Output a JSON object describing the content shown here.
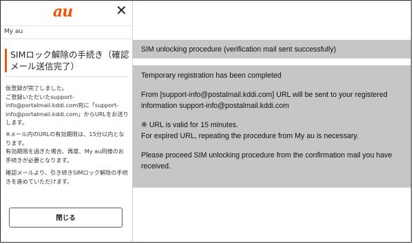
{
  "phone": {
    "logo": "au",
    "close_glyph": "✕",
    "breadcrumb": "My au",
    "title": "SIMロック解除の手続き（確認メール送信完了）",
    "paragraphs": [
      "仮登録が完了しました。\nご登録いただいたsupport-info@portalmail.kddi.com宛に「support-info@portalmail.kddi.com」からURLをお送りします。",
      "※メール内のURLの有効期限は、15分以内となります。\n有効期限を過ぎた場合、再度、My au同様のお手続きが必要となります。",
      "確認メールより、引き続きSIMロック解除の手続きを進めていただけます。"
    ],
    "close_button": "閉じる"
  },
  "callouts": {
    "header": "SIM unlocking procedure (verification mail sent successfully)",
    "lines": [
      "Temporary registration has been completed",
      "",
      "From [support-info@postalmail.kddi.com] URL will be sent to your registered information support-info@postalmail.kddi.com",
      "",
      "※ URL is valid for 15 minutes.",
      "For expired URL, repeating the procedure from My au is necessary.",
      "",
      "Please proceed SIM unlocking procedure from the confirmation mail you have received."
    ]
  },
  "colors": {
    "brand": "#eb5505",
    "callout_bg": "#c6c6c6"
  }
}
